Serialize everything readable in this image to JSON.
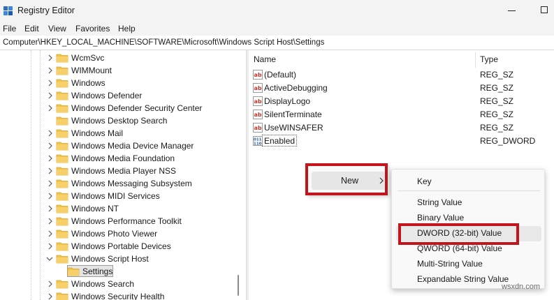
{
  "window": {
    "title": "Registry Editor"
  },
  "menu": [
    "File",
    "Edit",
    "View",
    "Favorites",
    "Help"
  ],
  "address": {
    "path": "Computer\\HKEY_LOCAL_MACHINE\\SOFTWARE\\Microsoft\\Windows Script Host\\Settings"
  },
  "tree": {
    "items": [
      {
        "label": "WcmSvc",
        "state": "collapsed"
      },
      {
        "label": "WIMMount",
        "state": "collapsed"
      },
      {
        "label": "Windows",
        "state": "collapsed"
      },
      {
        "label": "Windows Defender",
        "state": "collapsed"
      },
      {
        "label": "Windows Defender Security Center",
        "state": "collapsed"
      },
      {
        "label": "Windows Desktop Search",
        "state": "leaf"
      },
      {
        "label": "Windows Mail",
        "state": "collapsed"
      },
      {
        "label": "Windows Media Device Manager",
        "state": "collapsed"
      },
      {
        "label": "Windows Media Foundation",
        "state": "collapsed"
      },
      {
        "label": "Windows Media Player NSS",
        "state": "collapsed"
      },
      {
        "label": "Windows Messaging Subsystem",
        "state": "collapsed"
      },
      {
        "label": "Windows MIDI Services",
        "state": "collapsed"
      },
      {
        "label": "Windows NT",
        "state": "collapsed"
      },
      {
        "label": "Windows Performance Toolkit",
        "state": "collapsed"
      },
      {
        "label": "Windows Photo Viewer",
        "state": "collapsed"
      },
      {
        "label": "Windows Portable Devices",
        "state": "collapsed"
      },
      {
        "label": "Windows Script Host",
        "state": "expanded"
      },
      {
        "label": "Settings",
        "state": "selected"
      },
      {
        "label": "Windows Search",
        "state": "collapsed"
      },
      {
        "label": "Windows Security Health",
        "state": "collapsed"
      }
    ]
  },
  "values": {
    "columns": {
      "name": "Name",
      "type": "Type"
    },
    "rows": [
      {
        "name": "(Default)",
        "type": "REG_SZ",
        "icon": "string-value-icon"
      },
      {
        "name": "ActiveDebugging",
        "type": "REG_SZ",
        "icon": "string-value-icon"
      },
      {
        "name": "DisplayLogo",
        "type": "REG_SZ",
        "icon": "string-value-icon"
      },
      {
        "name": "SilentTerminate",
        "type": "REG_SZ",
        "icon": "string-value-icon"
      },
      {
        "name": "UseWINSAFER",
        "type": "REG_SZ",
        "icon": "string-value-icon"
      },
      {
        "name": "Enabled",
        "type": "REG_DWORD",
        "icon": "dword-value-icon"
      }
    ]
  },
  "context_menu": {
    "new_label": "New"
  },
  "submenu": {
    "items": [
      "Key",
      "String Value",
      "Binary Value",
      "DWORD (32-bit) Value",
      "QWORD (64-bit) Value",
      "Multi-String Value",
      "Expandable String Value"
    ],
    "highlighted": "DWORD (32-bit) Value"
  },
  "watermark": "wsxdn.com",
  "colors": {
    "highlight_box": "#c4141c",
    "folder": "#f2c24a",
    "string_icon": "#c0392b",
    "dword_icon": "#2c5aa0"
  }
}
